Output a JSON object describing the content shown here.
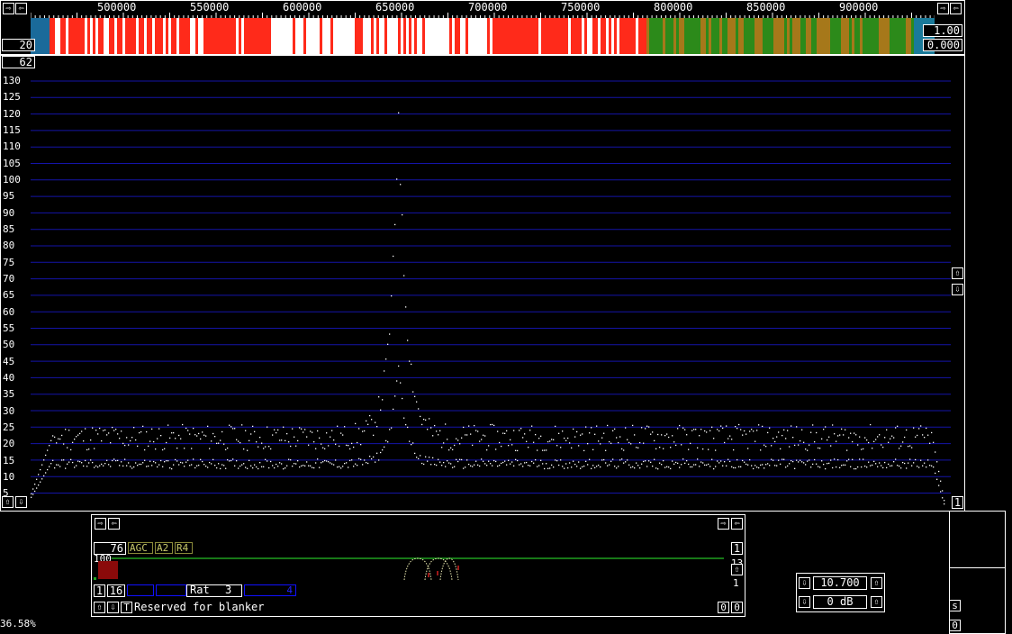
{
  "top_axis": {
    "freq_labels": [
      "500000",
      "550000",
      "600000",
      "650000",
      "700000",
      "750000",
      "800000",
      "850000",
      "900000"
    ]
  },
  "waterfall": {
    "left_value": "20",
    "right_top": "1.00",
    "right_bottom": "0.000"
  },
  "spectrum": {
    "level_box": "62",
    "y_labels": [
      "130",
      "125",
      "120",
      "115",
      "110",
      "105",
      "100",
      "95",
      "90",
      "85",
      "80",
      "75",
      "70",
      "65",
      "60",
      "55",
      "50",
      "45",
      "40",
      "35",
      "30",
      "25",
      "20",
      "15",
      "10",
      "5"
    ],
    "right_box": "1"
  },
  "baseband": {
    "gain": "76",
    "agc_label": "AGC",
    "a2_label": "A2",
    "r4_label": "R4",
    "level_100": "100",
    "right_top_box": "1",
    "right_value_a": "13",
    "right_value_b": "1",
    "row2_a": "1",
    "row2_b": "16",
    "rat_label": "Rat",
    "rat_value": "3",
    "blue_box_value": "4",
    "status_text": "Reserved for blanker",
    "t_button": "T",
    "zero_a": "0",
    "zero_b": "0"
  },
  "freq_panel": {
    "frequency": "10.700",
    "gain": "0 dB"
  },
  "side_panel": {
    "s_button": "s",
    "zero_button": "0"
  },
  "cpu_load": "36.58%",
  "colors": {
    "grid": "#1414a8",
    "trace": "#ffffff",
    "waterfall_hot": "#ff2a1a",
    "waterfall_cool": "#2c8a1a",
    "filter_line": "#1fa01f",
    "gain_bar": "#8a0a0a"
  }
}
